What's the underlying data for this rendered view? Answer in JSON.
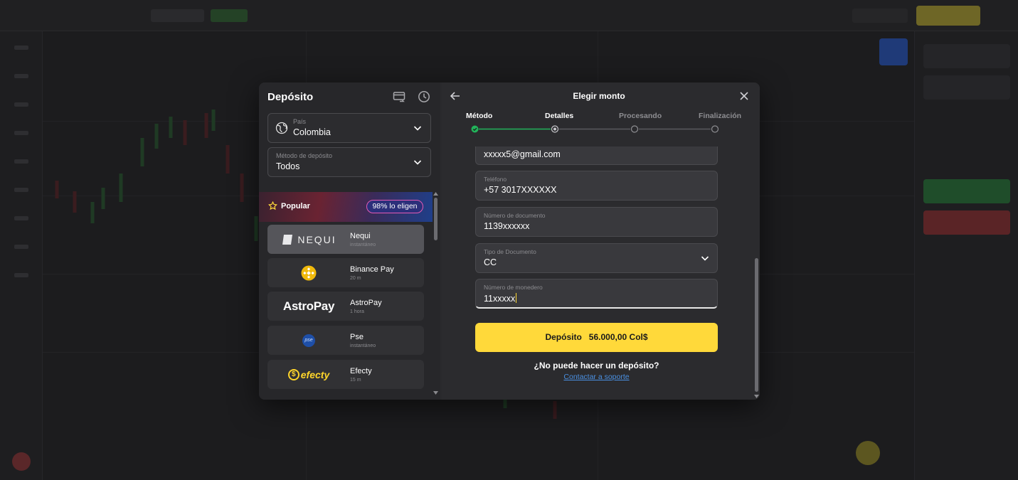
{
  "colors": {
    "accent": "#ffd93a",
    "success": "#22b35a",
    "link": "#4a90e2",
    "badge_border": "#e45ab4"
  },
  "deposit": {
    "title": "Depósito",
    "country": {
      "label": "País",
      "value": "Colombia"
    },
    "method_filter": {
      "label": "Método de depósito",
      "value": "Todos"
    },
    "popular": {
      "label": "Popular",
      "badge": "98% lo eligen"
    },
    "methods": [
      {
        "name": "Nequi",
        "time": "instantáneo",
        "logo_text": "NEQUI",
        "icon": "nequi-logo"
      },
      {
        "name": "Binance Pay",
        "time": "20 m",
        "icon": "binance-logo"
      },
      {
        "name": "AstroPay",
        "time": "1 hora",
        "logo_text": "AstroPay",
        "icon": "astropay-logo"
      },
      {
        "name": "Pse",
        "time": "instantáneo",
        "logo_text": "pse",
        "icon": "pse-logo"
      },
      {
        "name": "Efecty",
        "time": "15 m",
        "logo_text": "efecty",
        "icon": "efecty-logo"
      }
    ]
  },
  "amount": {
    "title": "Elegir monto",
    "steps": [
      {
        "label": "Método",
        "state": "done"
      },
      {
        "label": "Detalles",
        "state": "current"
      },
      {
        "label": "Procesando",
        "state": "pending"
      },
      {
        "label": "Finalización",
        "state": "pending"
      }
    ],
    "fields": {
      "email": {
        "value": "xxxxx5@gmail.com"
      },
      "phone": {
        "label": "Teléfono",
        "value": "+57 3017XXXXXX"
      },
      "document_number": {
        "label": "Número de documento",
        "value": "1139xxxxxx"
      },
      "document_type": {
        "label": "Tipo de Documento",
        "value": "CC"
      },
      "wallet_number": {
        "label": "Número de monedero",
        "value": "11xxxxx"
      }
    },
    "deposit_button": "Depósito   56.000,00 Col$",
    "help_question": "¿No puede hacer un depósito?",
    "help_link": "Contactar a soporte"
  }
}
